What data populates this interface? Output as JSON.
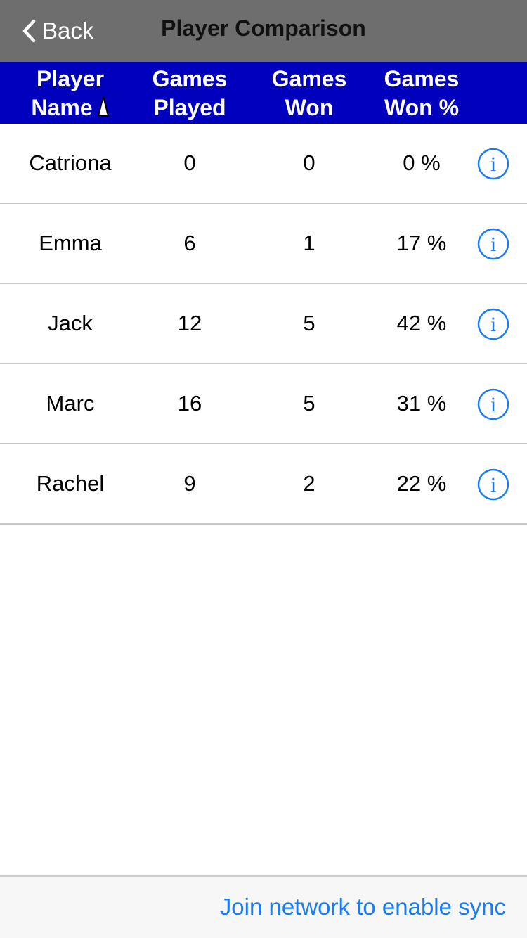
{
  "nav": {
    "back_label": "Back",
    "title": "Player Comparison"
  },
  "columns": {
    "name": [
      "Player",
      "Name"
    ],
    "played": [
      "Games",
      "Played"
    ],
    "won": [
      "Games",
      "Won"
    ],
    "pct": [
      "Games",
      "Won %"
    ],
    "sorted_by": "name",
    "sort_direction": "ascending"
  },
  "players": [
    {
      "name": "Catriona",
      "played": "0",
      "won": "0",
      "pct": "0 %"
    },
    {
      "name": "Emma",
      "played": "6",
      "won": "1",
      "pct": "17 %"
    },
    {
      "name": "Jack",
      "played": "12",
      "won": "5",
      "pct": "42 %"
    },
    {
      "name": "Marc",
      "played": "16",
      "won": "5",
      "pct": "31 %"
    },
    {
      "name": "Rachel",
      "played": "9",
      "won": "2",
      "pct": "22 %"
    }
  ],
  "toolbar": {
    "sync_label": "Join network to enable sync"
  },
  "icons": {
    "back": "chevron-left-icon",
    "sort": "sort-ascending-icon",
    "info": "info-circle-icon"
  },
  "colors": {
    "navbar": "#6e6e6e",
    "header": "#0000bd",
    "accent": "#1a7cf5"
  }
}
